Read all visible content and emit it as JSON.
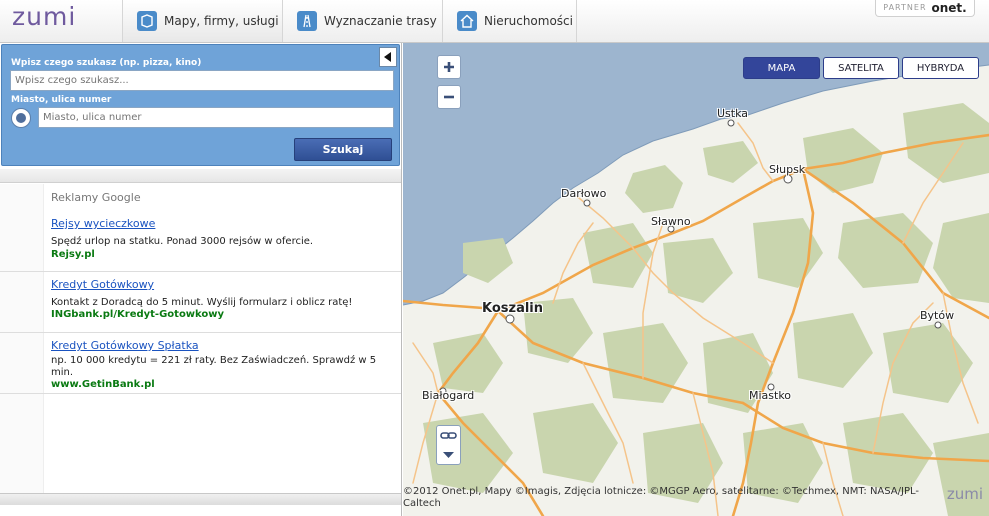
{
  "header": {
    "logo": "zumi",
    "tabs": [
      {
        "label": "Mapy, firmy, usługi",
        "icon": "map-pin-icon",
        "active": true
      },
      {
        "label": "Wyznaczanie trasy",
        "icon": "road-icon",
        "active": false
      },
      {
        "label": "Nieruchomości",
        "icon": "house-icon",
        "active": false
      }
    ],
    "partner_label": "PARTNER",
    "partner_brand": "onet."
  },
  "search": {
    "what_label": "Wpisz czego szukasz (np. pizza, kino)",
    "what_placeholder": "Wpisz czego szukasz...",
    "where_label": "Miasto, ulica numer",
    "where_placeholder": "Miasto, ulica numer",
    "button": "Szukaj"
  },
  "ads": {
    "header": "Reklamy Google",
    "items": [
      {
        "title": "Rejsy wycieczkowe",
        "text": "Spędź urlop na statku. Ponad 3000 rejsów w ofercie.",
        "url": "Rejsy.pl"
      },
      {
        "title": "Kredyt Gotówkowy",
        "text": "Kontakt z Doradcą do 5 minut. Wyślij formularz i oblicz ratę!",
        "url": "INGbank.pl/Kredyt-Gotowkowy"
      },
      {
        "title": "Kredyt Gotówkowy Spłatka",
        "text": "np. 10 000 kredytu = 221 zł raty. Bez Zaświadczeń. Sprawdź w 5 min.",
        "url": "www.GetinBank.pl"
      }
    ]
  },
  "map": {
    "types": [
      {
        "label": "MAPA",
        "active": true
      },
      {
        "label": "SATELITA",
        "active": false
      },
      {
        "label": "HYBRYDA",
        "active": false
      }
    ],
    "cities": [
      "Ustka",
      "Słupsk",
      "Darłowo",
      "Sławno",
      "Koszalin",
      "Bytów",
      "Białogard",
      "Miastko"
    ],
    "copyright": "©2012 Onet.pl, Mapy ©Imagis, Zdjęcia lotnicze: ©MGGP Aero, satelitarne: ©Techmex, NMT: NASA/JPL-Caltech",
    "watermark": "zumi",
    "colors": {
      "sea": "#9db5cf",
      "land": "#f2f2ec",
      "forest": "#c9d5ae",
      "road": "#f0a64a",
      "main_road": "#e88b2b"
    }
  }
}
